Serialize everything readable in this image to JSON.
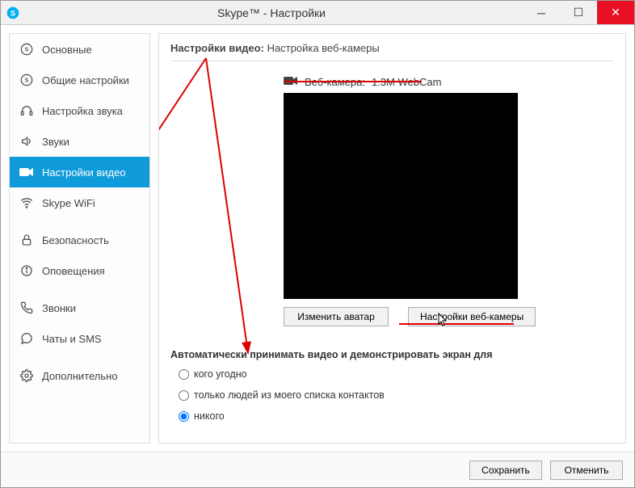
{
  "window": {
    "title": "Skype™ - Настройки"
  },
  "sidebar": {
    "items": [
      {
        "label": "Основные",
        "icon": "skype"
      },
      {
        "label": "Общие настройки",
        "icon": "skype"
      },
      {
        "label": "Настройка звука",
        "icon": "headset"
      },
      {
        "label": "Звуки",
        "icon": "speaker"
      },
      {
        "label": "Настройки видео",
        "icon": "camera",
        "active": true
      },
      {
        "label": "Skype WiFi",
        "icon": "wifi"
      },
      {
        "label": "Безопасность",
        "icon": "lock",
        "gapBefore": true
      },
      {
        "label": "Оповещения",
        "icon": "info"
      },
      {
        "label": "Звонки",
        "icon": "phone",
        "gapBefore": true
      },
      {
        "label": "Чаты и SMS",
        "icon": "chat"
      },
      {
        "label": "Дополнительно",
        "icon": "gear",
        "gapBefore": true
      }
    ]
  },
  "main": {
    "header_bold": "Настройки видео:",
    "header_rest": "Настройка веб-камеры",
    "webcam_label": "Веб-камера:",
    "webcam_name": "1.3M WebCam",
    "btn_avatar": "Изменить аватар",
    "btn_webcam": "Настройки веб-камеры",
    "auto_label": "Автоматически принимать видео и демонстрировать экран для",
    "radios": [
      {
        "value": "anyone",
        "label": "кого угодно"
      },
      {
        "value": "contacts",
        "label": "только людей из моего списка контактов"
      },
      {
        "value": "nobody",
        "label": "никого",
        "checked": true
      }
    ]
  },
  "footer": {
    "save": "Сохранить",
    "cancel": "Отменить"
  }
}
